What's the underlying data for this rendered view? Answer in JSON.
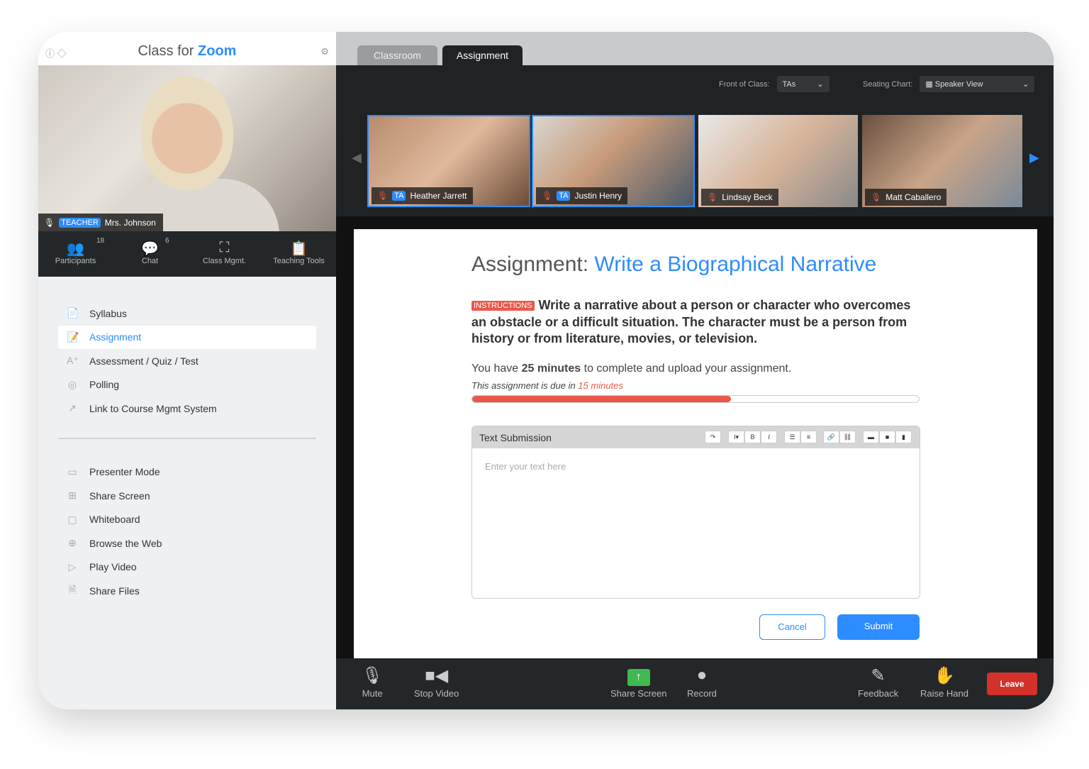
{
  "app": {
    "title_prefix": "Class for ",
    "title_brand": "Zoom"
  },
  "teacher": {
    "role": "TEACHER",
    "name": "Mrs. Johnson"
  },
  "toolbar": [
    {
      "label": "Participants",
      "count": "18"
    },
    {
      "label": "Chat",
      "count": "6"
    },
    {
      "label": "Class Mgmt."
    },
    {
      "label": "Teaching Tools"
    }
  ],
  "menu1": [
    {
      "label": "Syllabus",
      "icon": "📄"
    },
    {
      "label": "Assignment",
      "icon": "📝"
    },
    {
      "label": "Assessment / Quiz / Test",
      "icon": "A⁺"
    },
    {
      "label": "Polling",
      "icon": "◎"
    },
    {
      "label": "Link to Course Mgmt System",
      "icon": "↗"
    }
  ],
  "menu2": [
    {
      "label": "Presenter Mode",
      "icon": "▭"
    },
    {
      "label": "Share Screen",
      "icon": "⊞"
    },
    {
      "label": "Whiteboard",
      "icon": "▢"
    },
    {
      "label": "Browse the Web",
      "icon": "⊕"
    },
    {
      "label": "Play Video",
      "icon": "▷"
    },
    {
      "label": "Share Files",
      "icon": "🗎"
    }
  ],
  "tabs": [
    "Classroom",
    "Assignment"
  ],
  "front_of_class": {
    "label": "Front of Class:",
    "value": "TAs"
  },
  "seating_chart": {
    "label": "Seating Chart:",
    "value": "Speaker View"
  },
  "students": [
    {
      "name": "Heather Jarrett",
      "badge": "TA"
    },
    {
      "name": "Justin Henry",
      "badge": "TA"
    },
    {
      "name": "Lindsay Beck"
    },
    {
      "name": "Matt Caballero"
    }
  ],
  "assignment": {
    "prefix": "Assignment: ",
    "title": "Write a Biographical Narrative",
    "instructions_badge": "INSTRUCTIONS",
    "instructions": "Write a narrative about a person or character who overcomes an obstacle or a difficult situation. The character must be a person from history or from literature, movies, or television.",
    "time_pre": "You have ",
    "time_value": "25 minutes",
    "time_post": " to complete and upload your assignment.",
    "due_pre": "This assignment is due in ",
    "due_value": "15 minutes",
    "progress_percent": 58
  },
  "submission": {
    "label": "Text Submission",
    "placeholder": "Enter your text here",
    "cancel": "Cancel",
    "submit": "Submit"
  },
  "bottom": {
    "mute": "Mute",
    "stop_video": "Stop Video",
    "share_screen": "Share Screen",
    "record": "Record",
    "feedback": "Feedback",
    "raise_hand": "Raise Hand",
    "leave": "Leave"
  },
  "colors": {
    "accent": "#2d8cff",
    "danger": "#e8594a",
    "leave": "#d3312a"
  }
}
